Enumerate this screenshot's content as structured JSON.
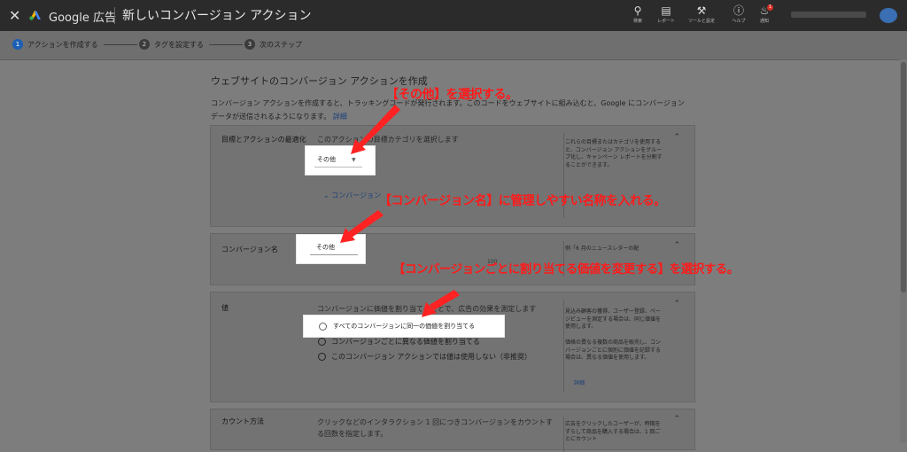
{
  "topbar": {
    "brand": "Google 広告",
    "title": "新しいコンバージョン アクション",
    "icons": [
      {
        "name": "search-icon",
        "label": "検索"
      },
      {
        "name": "report-icon",
        "label": "レポート"
      },
      {
        "name": "tools-icon",
        "label": "ツールと設定"
      },
      {
        "name": "help-icon",
        "label": "ヘルプ"
      },
      {
        "name": "bell-icon",
        "label": "通知"
      }
    ],
    "notification_count": "1"
  },
  "steps": [
    {
      "number": "1",
      "label": "アクションを作成する"
    },
    {
      "number": "2",
      "label": "タグを設定する"
    },
    {
      "number": "3",
      "label": "次のステップ"
    }
  ],
  "main": {
    "heading": "ウェブサイトのコンバージョン アクションを作成",
    "intro": "コンバージョン アクションを作成すると、トラッキングコードが発行されます。このコードをウェブサイトに組み込むと、Google にコンバージョン データが送信されるようになります。",
    "intro_link": "詳細"
  },
  "cards": {
    "goal": {
      "label": "目標とアクションの最適化",
      "desc": "このアクションの目標カテゴリを選択します",
      "select_value": "その他",
      "sub_link": "コンバージョン",
      "right": "これらの目標またはカテゴリを使用すると、コンバージョン アクションをグループ化し、キャンペーン レポートを分割することができます。"
    },
    "name": {
      "label": "コンバージョン名",
      "value": "その他",
      "right": "例「6 月のニュースレターの配"
    },
    "value": {
      "label": "値",
      "desc": "コンバージョンに価値を割り当てることで、広告の効果を測定します",
      "options": [
        "すべてのコンバージョンに同一の価値を割り当てる",
        "コンバージョンごとに異なる価値を割り当てる",
        "このコンバージョン アクションでは値は使用しない（非推奨）"
      ],
      "right1": "見込み顧客の獲得、ユーザー登録、ページビューを測定する場合は、同じ価値を使用します。",
      "right2": "価格の異なる複数の商品を販売し、コンバージョンごとに個別に価値を記録する場合は、異なる価値を使用します。",
      "right_link": "詳細"
    },
    "count": {
      "label": "カウント方法",
      "desc": "クリックなどのインタラクション 1 回につきコンバージョンをカウントする回数を指定します。",
      "right": "広告をクリックしたユーザーが、時期をずらして商品を購入する場合は、1 回ごとにカウント"
    }
  },
  "annotations": {
    "a1": "【その他】を選択する。",
    "a2": "【コンバージョン名】に管理しやすい名称を入れる。",
    "a3": "【コンバージョンごとに割り当てる価値を変更する】を選択する。"
  },
  "colors": {
    "annotation": "#ff1a1a",
    "step_active": "#1a5fb4",
    "topbar": "#2b2b2b"
  }
}
